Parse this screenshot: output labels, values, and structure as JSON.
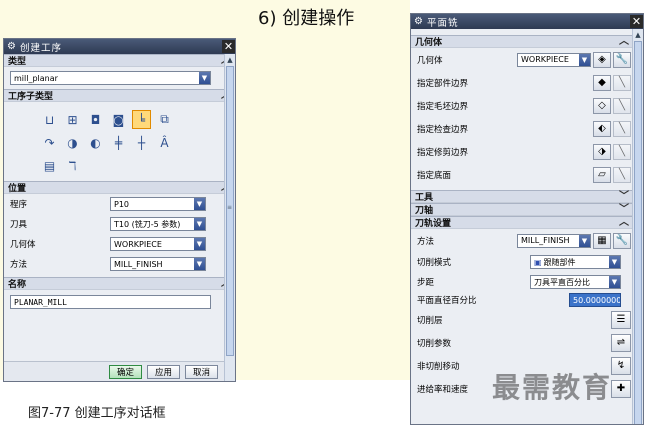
{
  "slide": {
    "title": "6) 创建操作",
    "caption": "图7-77   创建工序对话框",
    "watermark": "最需教育"
  },
  "create_dialog": {
    "title": "创建工序",
    "sections": {
      "type": "类型",
      "subtype": "工序子类型",
      "location": "位置",
      "name": "名称"
    },
    "type_value": "mill_planar",
    "subtype_icons": [
      "op-face-mill-icon",
      "op-face-mill-area-icon",
      "op-face-mill-manual-icon",
      "op-planar-mill-icon",
      "op-planar-profile-icon",
      "op-clean-corners-icon",
      "op-finish-walls-icon",
      "op-finish-floor-icon",
      "op-planar-text-icon",
      "op-thread-mill-icon",
      "op-groove-icon",
      "op-planar-text-a-icon",
      "op-mill-control-icon",
      "op-mill-user-icon"
    ],
    "location_rows": [
      {
        "label": "程序",
        "value": "P10"
      },
      {
        "label": "刀具",
        "value": "T10 (铣刀-5 参数)"
      },
      {
        "label": "几何体",
        "value": "WORKPIECE"
      },
      {
        "label": "方法",
        "value": "MILL_FINISH"
      }
    ],
    "name_value": "PLANAR_MILL",
    "buttons": {
      "ok": "确定",
      "apply": "应用",
      "cancel": "取消"
    }
  },
  "planar_dialog": {
    "title": "平面铣",
    "sections": {
      "geometry": "几何体",
      "tool": "工具",
      "axis": "刀轴",
      "path_settings": "刀轨设置"
    },
    "geometry": {
      "label": "几何体",
      "value": "WORKPIECE",
      "rows": [
        "指定部件边界",
        "指定毛坯边界",
        "指定检查边界",
        "指定修剪边界",
        "指定底面"
      ]
    },
    "path": {
      "method_label": "方法",
      "method_value": "MILL_FINISH",
      "cut_mode_label": "切削模式",
      "cut_mode_value": "跟随部件",
      "stepover_label": "步距",
      "stepover_value": "刀具平直百分比",
      "percent_label": "平面直径百分比",
      "percent_value": "50.0000000",
      "levels_label": "切削层",
      "cut_params_label": "切削参数",
      "non_cut_label": "非切削移动",
      "feeds_label": "进给率和速度"
    }
  },
  "colors": {
    "titlebar": "#2e3a52",
    "panel": "#ebeef3",
    "section": "#d6dce8",
    "dropdown": "#2f4f93",
    "highlight": "#ffd97a"
  }
}
